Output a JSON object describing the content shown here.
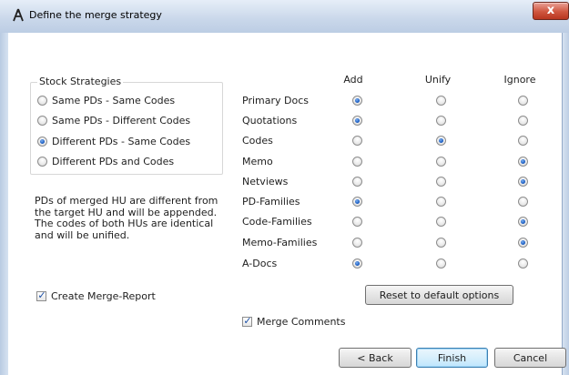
{
  "window": {
    "title": "Define the merge strategy",
    "close_label": "x"
  },
  "stock": {
    "title": "Stock Strategies",
    "options": [
      {
        "label": "Same PDs - Same Codes",
        "checked": false
      },
      {
        "label": "Same PDs - Different Codes",
        "checked": false
      },
      {
        "label": "Different PDs - Same Codes",
        "checked": true
      },
      {
        "label": "Different PDs and Codes",
        "checked": false
      }
    ]
  },
  "description": "PDs of merged HU are different from the target HU and will be appended. The codes of both HUs are identical and will be unified.",
  "columns": {
    "add": "Add",
    "unify": "Unify",
    "ignore": "Ignore"
  },
  "rows": [
    {
      "label": "Primary Docs",
      "selected": "add"
    },
    {
      "label": "Quotations",
      "selected": "add"
    },
    {
      "label": "Codes",
      "selected": "unify"
    },
    {
      "label": "Memo",
      "selected": "ignore"
    },
    {
      "label": "Netviews",
      "selected": "ignore"
    },
    {
      "label": "PD-Families",
      "selected": "add"
    },
    {
      "label": "Code-Families",
      "selected": "ignore"
    },
    {
      "label": "Memo-Families",
      "selected": "ignore"
    },
    {
      "label": "A-Docs",
      "selected": "add"
    }
  ],
  "create_report": {
    "label": "Create Merge-Report",
    "checked": true
  },
  "merge_comments": {
    "label": "Merge Comments",
    "checked": true
  },
  "buttons": {
    "reset": "Reset to default options",
    "back": "< Back",
    "finish": "Finish",
    "cancel": "Cancel"
  },
  "colors": {
    "title_bar": "#c9d7ea",
    "close_button": "#d0563f",
    "radio_selected": "#1c5fc5"
  }
}
